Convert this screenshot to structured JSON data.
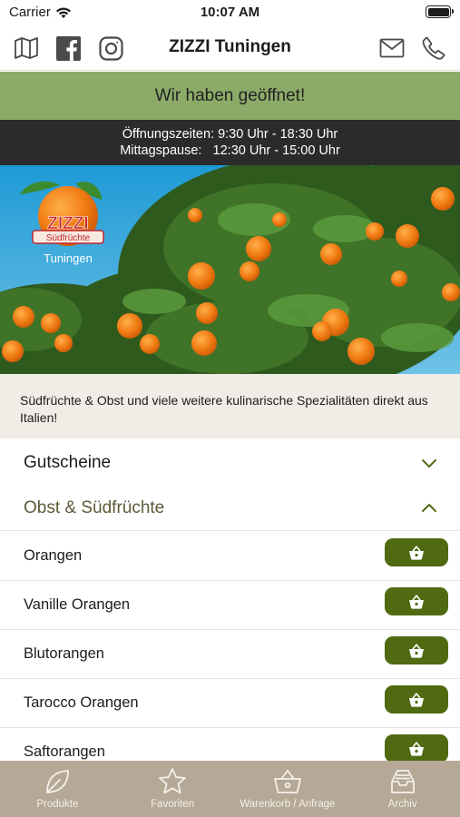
{
  "status_bar": {
    "carrier": "Carrier",
    "time": "10:07 AM"
  },
  "nav": {
    "title": "ZIZZI Tuningen",
    "left_icons": [
      "map-icon",
      "facebook-icon",
      "instagram-icon"
    ],
    "right_icons": [
      "mail-icon",
      "phone-icon"
    ]
  },
  "banner": {
    "open_text": "Wir haben geöffnet!"
  },
  "hours": {
    "line1": "Öffnungszeiten: 9:30 Uhr - 18:30 Uhr",
    "line2": "Mittagspause:   12:30 Uhr - 15:00 Uhr"
  },
  "hero": {
    "logo_text": "ZIZZI",
    "logo_ribbon": "Südfrüchte",
    "logo_place": "Tuningen"
  },
  "intro": {
    "text": "Südfrüchte & Obst und viele weitere kulinarische Spezialitäten direkt aus Italien!"
  },
  "sections": {
    "gutscheine": {
      "label": "Gutscheine",
      "state": "collapsed"
    },
    "obst": {
      "label": "Obst & Südfrüchte",
      "state": "expanded"
    }
  },
  "products": [
    {
      "label": "Orangen"
    },
    {
      "label": "Vanille Orangen"
    },
    {
      "label": "Blutorangen"
    },
    {
      "label": "Tarocco Orangen"
    },
    {
      "label": "Saftorangen"
    }
  ],
  "tabs": [
    {
      "label": "Produkte",
      "icon": "leaf-icon"
    },
    {
      "label": "Favoriten",
      "icon": "star-icon"
    },
    {
      "label": "Warenkorb / Anfrage",
      "icon": "basket-icon"
    },
    {
      "label": "Archiv",
      "icon": "archive-icon"
    }
  ],
  "colors": {
    "open_banner": "#8cab68",
    "hours_bg": "#2b2b2b",
    "accent_green": "#4f6a10",
    "section_text": "#5c5a38",
    "intro_bg": "#f1ede6",
    "tab_bar": "#b5a896"
  }
}
